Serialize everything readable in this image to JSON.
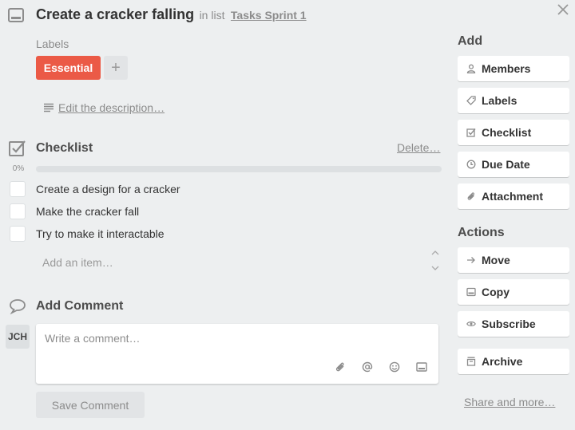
{
  "header": {
    "title": "Create a cracker falling",
    "in_list": "in list",
    "list_name": "Tasks Sprint 1"
  },
  "labels": {
    "heading": "Labels",
    "items": [
      {
        "text": "Essential",
        "color": "#eb5a46"
      }
    ],
    "add_symbol": "+"
  },
  "description": {
    "link": "Edit the description…"
  },
  "checklist": {
    "title": "Checklist",
    "delete": "Delete…",
    "progress_label": "0%",
    "progress": 0,
    "items": [
      {
        "text": "Create a design for a cracker",
        "checked": false
      },
      {
        "text": "Make the cracker fall",
        "checked": false
      },
      {
        "text": "Try to make it interactable",
        "checked": false
      }
    ],
    "add_item_placeholder": "Add an item…"
  },
  "comment": {
    "title": "Add Comment",
    "avatar_initials": "JCH",
    "placeholder": "Write a comment…",
    "save_label": "Save Comment"
  },
  "sidebar": {
    "add_heading": "Add",
    "add_items": [
      {
        "label": "Members",
        "icon": "person-icon"
      },
      {
        "label": "Labels",
        "icon": "tag-icon"
      },
      {
        "label": "Checklist",
        "icon": "checkbox-icon"
      },
      {
        "label": "Due Date",
        "icon": "clock-icon"
      },
      {
        "label": "Attachment",
        "icon": "paperclip-icon"
      }
    ],
    "actions_heading": "Actions",
    "action_items": [
      {
        "label": "Move",
        "icon": "arrow-right-icon"
      },
      {
        "label": "Copy",
        "icon": "card-icon"
      },
      {
        "label": "Subscribe",
        "icon": "eye-icon"
      },
      {
        "label": "Archive",
        "icon": "archive-icon"
      }
    ],
    "share_link": "Share and more…"
  },
  "colors": {
    "background": "#edeff0",
    "label_red": "#eb5a46",
    "progress_track": "#dde0e2"
  }
}
